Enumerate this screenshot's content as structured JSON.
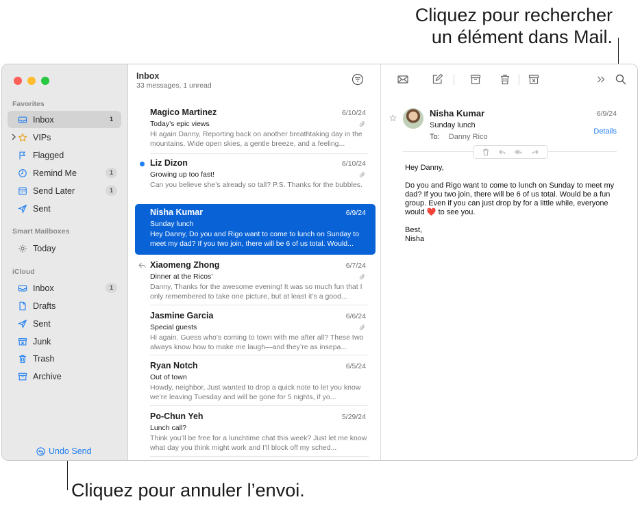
{
  "callouts": {
    "top_line1": "Cliquez pour rechercher",
    "top_line2": "un élément dans Mail.",
    "bottom": "Cliquez pour annuler l’envoi."
  },
  "sidebar": {
    "favorites_header": "Favorites",
    "favorites": [
      {
        "label": "Inbox",
        "badge": "1",
        "icon": "inbox-icon",
        "active": true
      },
      {
        "label": "VIPs",
        "badge": "",
        "icon": "star-icon"
      },
      {
        "label": "Flagged",
        "badge": "",
        "icon": "flag-icon"
      },
      {
        "label": "Remind Me",
        "badge": "1",
        "icon": "clock-icon"
      },
      {
        "label": "Send Later",
        "badge": "1",
        "icon": "calendar-icon"
      },
      {
        "label": "Sent",
        "badge": "",
        "icon": "paperplane-icon"
      }
    ],
    "smart_header": "Smart Mailboxes",
    "smart": [
      {
        "label": "Today",
        "icon": "gear-icon"
      }
    ],
    "icloud_header": "iCloud",
    "icloud": [
      {
        "label": "Inbox",
        "badge": "1",
        "icon": "inbox-icon"
      },
      {
        "label": "Drafts",
        "badge": "",
        "icon": "document-icon"
      },
      {
        "label": "Sent",
        "badge": "",
        "icon": "paperplane-icon"
      },
      {
        "label": "Junk",
        "badge": "",
        "icon": "junk-icon"
      },
      {
        "label": "Trash",
        "badge": "",
        "icon": "trash-icon"
      },
      {
        "label": "Archive",
        "badge": "",
        "icon": "archive-icon"
      }
    ],
    "undo_label": "Undo Send"
  },
  "list": {
    "title": "Inbox",
    "subtitle": "33 messages, 1 unread",
    "messages": [
      {
        "sender": "Magico Martinez",
        "date": "6/10/24",
        "subject": "Today’s epic views",
        "preview": "Hi again Danny, Reporting back on another breathtaking day in the mountains. Wide open skies, a gentle breeze, and a feeling...",
        "attachment": true
      },
      {
        "sender": "Liz Dizon",
        "date": "6/10/24",
        "subject": "Growing up too fast!",
        "preview": "Can you believe she’s already so tall? P.S. Thanks for the bubbles.",
        "attachment": true,
        "unread": true
      },
      {
        "sender": "Nisha Kumar",
        "date": "6/9/24",
        "subject": "Sunday lunch",
        "preview": "Hey Danny, Do you and Rigo want to come to lunch on Sunday to meet my dad? If you two join, there will be 6 of us total. Would...",
        "selected": true
      },
      {
        "sender": "Xiaomeng Zhong",
        "date": "6/7/24",
        "subject": "Dinner at the Ricos’",
        "preview": "Danny, Thanks for the awesome evening! It was so much fun that I only remembered to take one picture, but at least it’s a good...",
        "attachment": true,
        "replied": true
      },
      {
        "sender": "Jasmine Garcia",
        "date": "6/6/24",
        "subject": "Special guests",
        "preview": "Hi again. Guess who’s coming to town with me after all? These two always know how to make me laugh—and they’re as insepa...",
        "attachment": true
      },
      {
        "sender": "Ryan Notch",
        "date": "6/5/24",
        "subject": "Out of town",
        "preview": "Howdy, neighbor, Just wanted to drop a quick note to let you know we’re leaving Tuesday and will be gone for 5 nights, if yo..."
      },
      {
        "sender": "Po-Chun Yeh",
        "date": "5/29/24",
        "subject": "Lunch call?",
        "preview": "Think you’ll be free for a lunchtime chat this week? Just let me know what day you think might work and I’ll block off my sched..."
      }
    ]
  },
  "reader": {
    "from": "Nisha Kumar",
    "date": "6/9/24",
    "subject": "Sunday lunch",
    "to_label": "To:",
    "to_name": "Danny Rico",
    "details_label": "Details",
    "greeting": "Hey Danny,",
    "paragraph_before_heart": "Do you and Rigo want to come to lunch on Sunday to meet my dad? If you two join, there will be 6 of us total. Would be a fun group. Even if you can just drop by for a little while, everyone would",
    "heart": "❤️",
    "paragraph_after_heart": "to see you.",
    "signoff": "Best,",
    "signature": "Nisha"
  },
  "colors": {
    "accent": "#1e7ef0",
    "selection": "#0a63d6",
    "sidebar_bg": "#e9e9e9"
  }
}
